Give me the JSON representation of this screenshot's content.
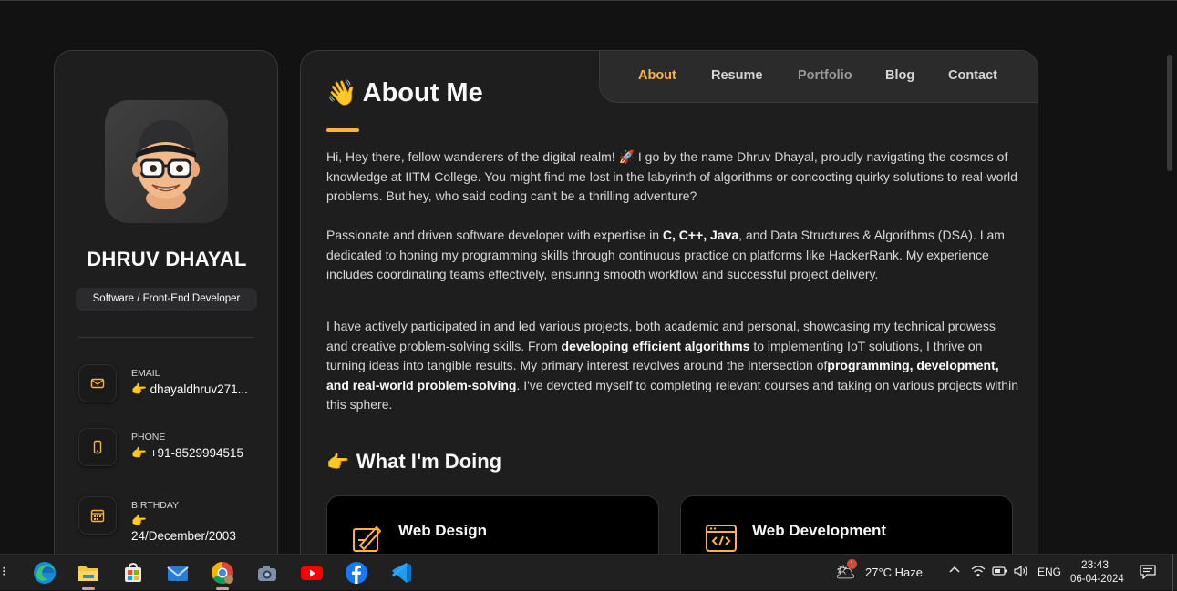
{
  "sidebar": {
    "name": "DHRUV DHAYAL",
    "role": "Software / Front-End Developer",
    "contacts": [
      {
        "title": "Email",
        "pointer": "👉",
        "value": "dhayaldhruv271..."
      },
      {
        "title": "Phone",
        "pointer": "👉",
        "value": "+91-8529994515"
      },
      {
        "title": "Birthday",
        "pointer": "👉",
        "value": "24/December/2003"
      }
    ],
    "icons": [
      "mail-icon",
      "phone-icon",
      "calendar-icon"
    ]
  },
  "nav": {
    "items": [
      "About",
      "Resume",
      "Portfolio",
      "Blog",
      "Contact"
    ],
    "active": "About"
  },
  "about": {
    "emoji": "👋",
    "title": "About Me",
    "p1_text": "Hi, Hey there, fellow wanderers of the digital realm! 🚀 I go by the name Dhruv Dhayal, proudly navigating the cosmos of knowledge at IITM College. You might find me lost in the labyrinth of algorithms or concocting quirky solutions to real-world problems. But hey, who said coding can't be a thrilling adventure?",
    "p2_a": "Passionate and driven software developer with expertise in ",
    "p2_b": "C, C++, Java",
    "p2_c": ", and Data Structures & Algorithms (DSA). I am dedicated to honing my programming skills through continuous practice on platforms like HackerRank. My experience includes coordinating teams effectively, ensuring smooth workflow and successful project delivery.",
    "p3_a": "I have actively participated in and led various projects, both academic and personal, showcasing my technical prowess and creative problem-solving skills. From ",
    "p3_b": "developing efficient algorithms",
    "p3_c": " to implementing IoT solutions, I thrive on turning ideas into tangible results. My primary interest revolves around the intersection of",
    "p3_d": "programming, development, and real-world problem-solving",
    "p3_e": ". I've devoted myself to completing relevant courses and taking on various projects within this sphere."
  },
  "doing": {
    "emoji": "👉",
    "title": "What I'm Doing",
    "cards": [
      {
        "title": "Web Design",
        "icon": "design-icon"
      },
      {
        "title": "Web Development",
        "icon": "code-icon"
      }
    ]
  },
  "taskbar": {
    "apps": [
      "edge-icon",
      "file-explorer-icon",
      "store-icon",
      "mail-app-icon",
      "chrome-icon",
      "camera-icon",
      "youtube-icon",
      "facebook-icon",
      "vscode-icon"
    ],
    "weather_badge": "1",
    "weather": "27°C  Haze",
    "language": "ENG",
    "time": "23:43",
    "date": "06-04-2024"
  },
  "colors": {
    "accent": "#ffb23f",
    "background": "#121212",
    "panel": "#1e1e1f"
  }
}
